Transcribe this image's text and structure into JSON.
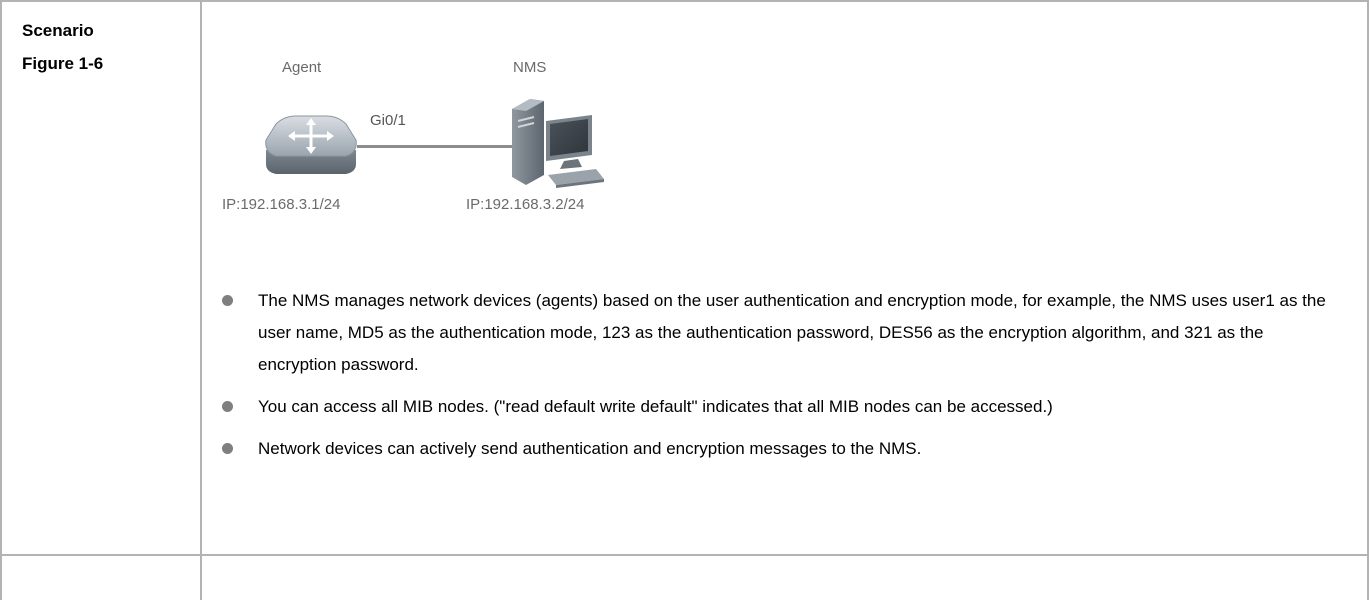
{
  "labels": {
    "scenario": "Scenario",
    "figure": "Figure 1-6"
  },
  "figure": {
    "agent_label": "Agent",
    "nms_label": "NMS",
    "port_label": "Gi0/1",
    "agent_ip": "IP:192.168.3.1/24",
    "nms_ip": "IP:192.168.3.2/24",
    "icons": [
      "switch-icon",
      "computer-icon"
    ]
  },
  "bullets": [
    "The NMS manages network devices (agents) based on the user authentication and encryption mode, for example, the NMS uses user1 as the user name, MD5 as the authentication mode, 123 as the authentication password, DES56 as the encryption algorithm, and 321 as the encryption password.",
    "You can access all MIB nodes. (\"read default write default\" indicates that all MIB nodes can be accessed.)",
    "Network devices can actively send authentication and encryption messages to the NMS."
  ],
  "colors": {
    "border": "#b3b3b3",
    "bullet": "#7f7f7f",
    "figure_text": "#6a6a6a"
  }
}
